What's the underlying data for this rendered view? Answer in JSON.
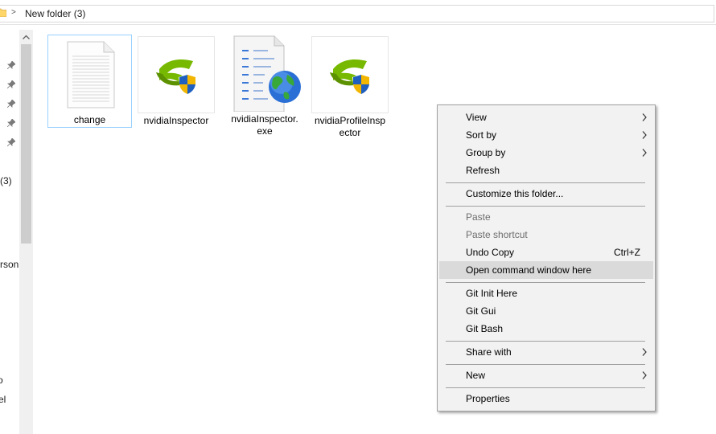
{
  "address": {
    "separator": ">",
    "crumb": "New folder (3)"
  },
  "nav": {
    "items": [
      "(3)",
      "rson",
      "o",
      "el"
    ]
  },
  "files": [
    {
      "name": "change",
      "icon": "text-document-icon"
    },
    {
      "name": "nvidiaInspector",
      "icon": "nvidia-shield-icon"
    },
    {
      "name": "nvidiaInspector.exe",
      "icon": "document-globe-icon"
    },
    {
      "name": "nvidiaProfileInspector",
      "icon": "nvidia-shield-icon"
    }
  ],
  "context_menu": {
    "items": [
      {
        "label": "View",
        "submenu": true
      },
      {
        "label": "Sort by",
        "submenu": true
      },
      {
        "label": "Group by",
        "submenu": true
      },
      {
        "label": "Refresh"
      },
      {
        "label": "Customize this folder..."
      },
      {
        "label": "Paste",
        "disabled": true
      },
      {
        "label": "Paste shortcut",
        "disabled": true
      },
      {
        "label": "Undo Copy",
        "shortcut": "Ctrl+Z"
      },
      {
        "label": "Open command window here",
        "highlighted": true
      },
      {
        "label": "Git Init Here"
      },
      {
        "label": "Git Gui"
      },
      {
        "label": "Git Bash"
      },
      {
        "label": "Share with",
        "submenu": true
      },
      {
        "label": "New",
        "submenu": true
      },
      {
        "label": "Properties"
      }
    ]
  },
  "colors": {
    "selection_border": "#99d1ff",
    "menu_background": "#f2f2f2",
    "menu_highlight": "#dadada",
    "nvidia_green": "#76b900",
    "folder_yellow": "#ffd769"
  }
}
